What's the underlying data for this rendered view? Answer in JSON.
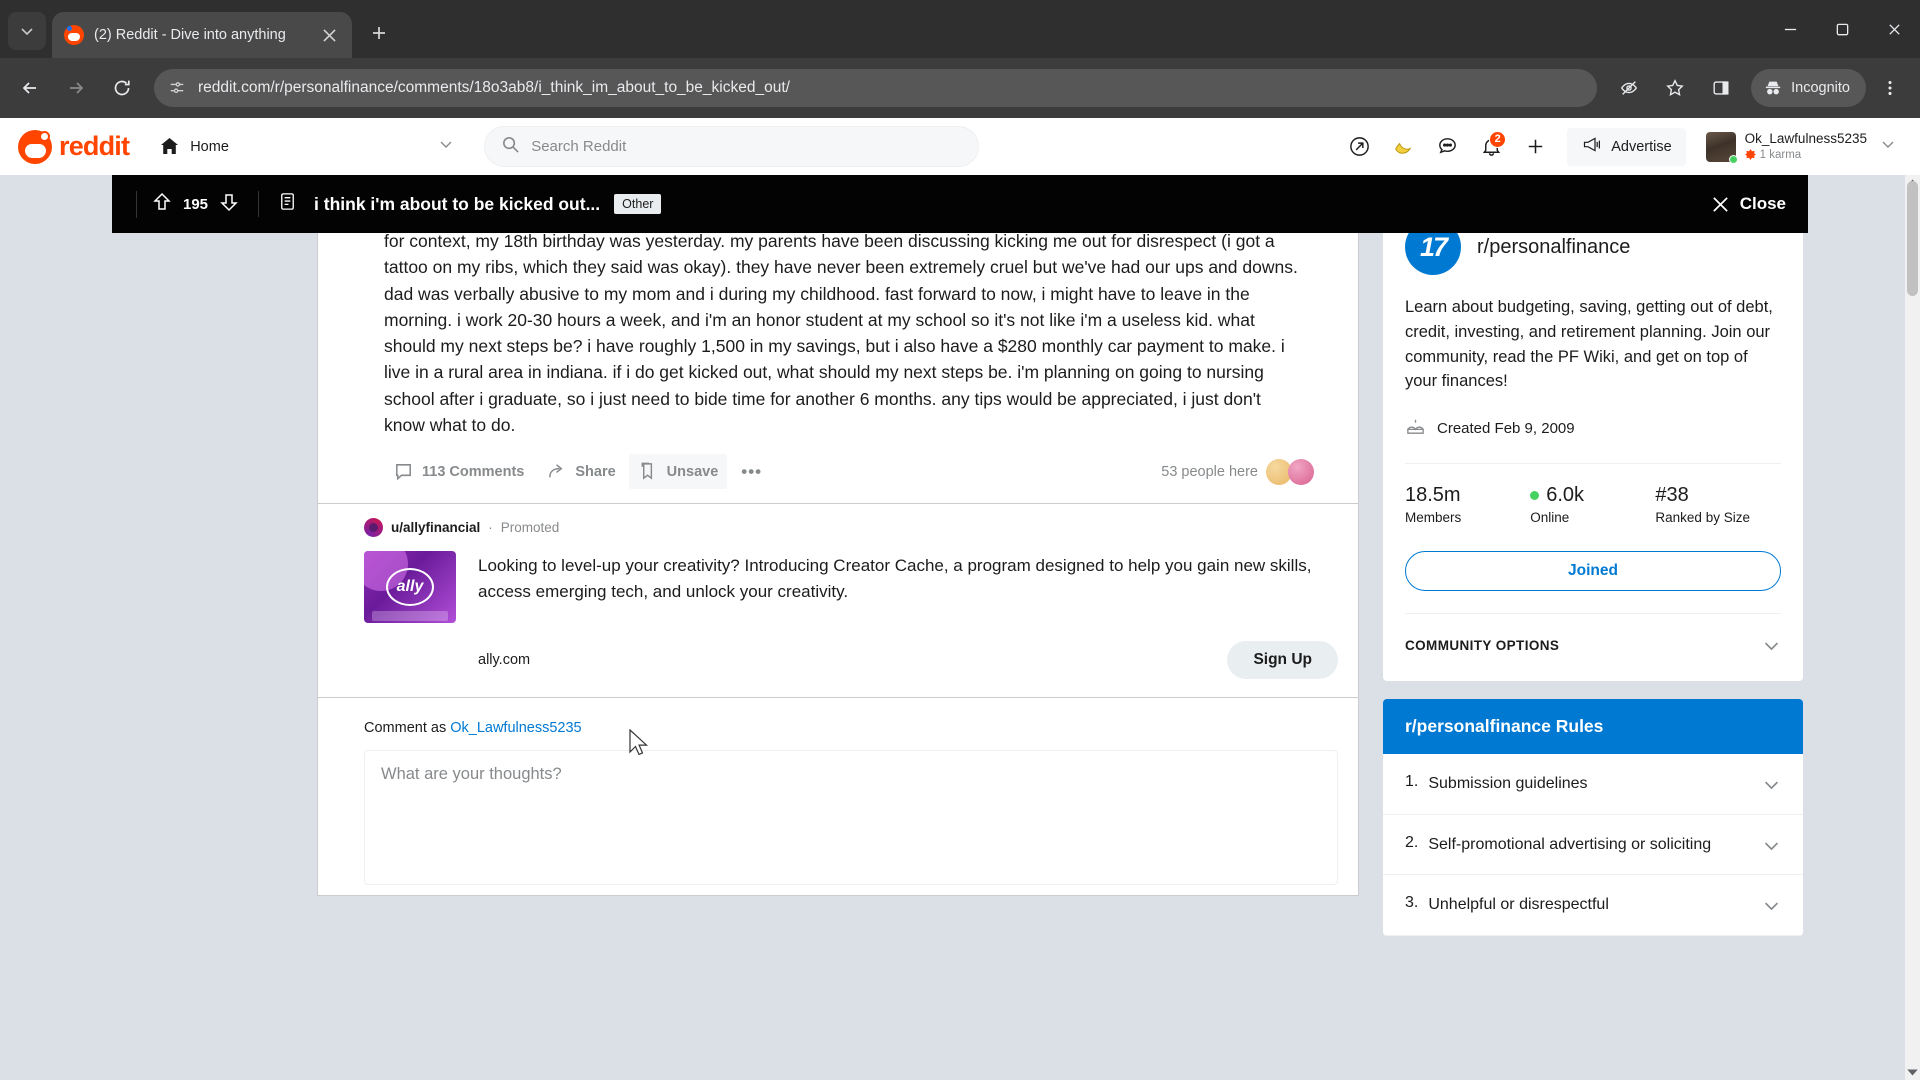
{
  "browser": {
    "tab": {
      "title": "(2) Reddit - Dive into anything",
      "favicon": "reddit-icon"
    },
    "url": "reddit.com/r/personalfinance/comments/18o3ab8/i_think_im_about_to_be_kicked_out/",
    "profile_label": "Incognito",
    "icons": {
      "tab_search": "chevron-down-icon",
      "new_tab": "plus-icon",
      "back": "arrow-left-icon",
      "forward": "arrow-right-icon",
      "reload": "reload-icon",
      "site_info": "page-settings-icon",
      "tracking": "eye-off-icon",
      "bookmark": "star-icon",
      "side_panel": "side-panel-icon",
      "menu": "three-dot-menu-icon",
      "minimize": "minimize-icon",
      "maximize": "maximize-icon",
      "close": "window-close-icon"
    }
  },
  "reddit_header": {
    "wordmark": "reddit",
    "home_label": "Home",
    "search_placeholder": "Search Reddit",
    "search_value": "",
    "advertise_label": "Advertise",
    "notifications_badge": "2",
    "user": {
      "name": "Ok_Lawfulness5235",
      "karma": "1 karma"
    }
  },
  "overlay_bar": {
    "score": "195",
    "title": "i think i'm about to be kicked out...",
    "flair": "Other",
    "close_label": "Close"
  },
  "post": {
    "flair": "Other",
    "body": "for context, my 18th birthday was yesterday. my parents have been discussing kicking me out for disrespect (i got a tattoo on my ribs, which they said was okay). they have never been extremely cruel but we've had our ups and downs. dad was verbally abusive to my mom and i during my childhood. fast forward to now, i might have to leave in the morning. i work 20-30 hours a week, and i'm an honor student at my school so it's not like i'm a useless kid. what should my next steps be? i have roughly 1,500 in my savings, but i also have a $280 monthly car payment to make. i live in a rural area in indiana. if i do get kicked out, what should my next steps be. i'm planning on going to nursing school after i graduate, so i just need to bide time for another 6 months. any tips would be appreciated, i just don't know what to do.",
    "comments_label": "113 Comments",
    "share_label": "Share",
    "save_label": "Unsave",
    "more_label": "•••",
    "people_here": "53 people here"
  },
  "ad": {
    "author": "u/allyfinancial",
    "separator": "·",
    "promoted_label": "Promoted",
    "thumb_text": "ally",
    "text": "Looking to level-up your creativity? Introducing Creator Cache, a program designed to help you gain new skills, access emerging tech, and unlock your creativity.",
    "link": "ally.com",
    "cta": "Sign Up"
  },
  "comment_form": {
    "prefix": "Comment as",
    "username": "Ok_Lawfulness5235",
    "placeholder": "What are your thoughts?"
  },
  "sidebar": {
    "subreddit": "r/personalfinance",
    "avatar_text": "17",
    "description": "Learn about budgeting, saving, getting out of debt, credit, investing, and retirement planning. Join our community, read the PF Wiki, and get on top of your finances!",
    "created": "Created Feb 9, 2009",
    "stats": [
      {
        "value": "18.5m",
        "label": "Members",
        "online": false
      },
      {
        "value": "6.0k",
        "label": "Online",
        "online": true
      },
      {
        "value": "#38",
        "label": "Ranked by Size",
        "online": false
      }
    ],
    "joined_label": "Joined",
    "community_options_label": "COMMUNITY OPTIONS",
    "rules_title": "r/personalfinance Rules",
    "rules": [
      {
        "num": "1.",
        "text": "Submission guidelines"
      },
      {
        "num": "2.",
        "text": "Self-promotional advertising or soliciting"
      },
      {
        "num": "3.",
        "text": "Unhelpful or disrespectful"
      }
    ]
  },
  "colors": {
    "reddit_orange": "#ff4500",
    "link_blue": "#0079d3",
    "online_green": "#46d160",
    "overlay_black": "#030303",
    "page_bg": "#dae0e6"
  }
}
